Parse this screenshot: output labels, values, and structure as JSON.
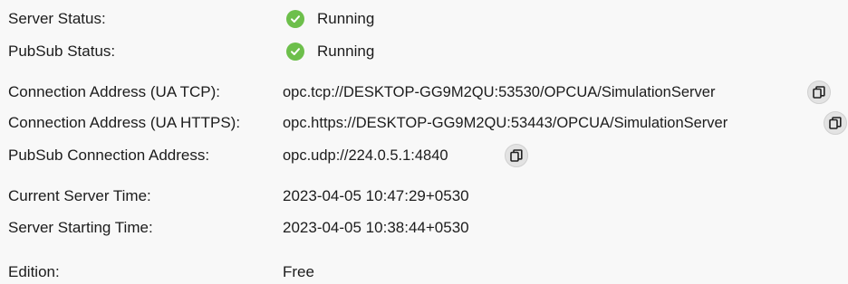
{
  "server_status": {
    "label": "Server Status:",
    "value": "Running",
    "icon": "check-circle-icon",
    "icon_color": "#6dbf4b"
  },
  "pubsub_status": {
    "label": "PubSub Status:",
    "value": "Running",
    "icon": "check-circle-icon",
    "icon_color": "#6dbf4b"
  },
  "connection_tcp": {
    "label": "Connection Address (UA TCP):",
    "value": "opc.tcp://DESKTOP-GG9M2QU:53530/OPCUA/SimulationServer",
    "icon": "copy-icon"
  },
  "connection_https": {
    "label": "Connection Address (UA HTTPS):",
    "value": "opc.https://DESKTOP-GG9M2QU:53443/OPCUA/SimulationServer",
    "icon": "copy-icon"
  },
  "pubsub_connection": {
    "label": "PubSub Connection Address:",
    "value": "opc.udp://224.0.5.1:4840",
    "icon": "copy-icon"
  },
  "current_time": {
    "label": "Current Server Time:",
    "value": "2023-04-05 10:47:29+0530"
  },
  "starting_time": {
    "label": "Server Starting Time:",
    "value": "2023-04-05 10:38:44+0530"
  },
  "edition": {
    "label": "Edition:",
    "value": "Free"
  }
}
